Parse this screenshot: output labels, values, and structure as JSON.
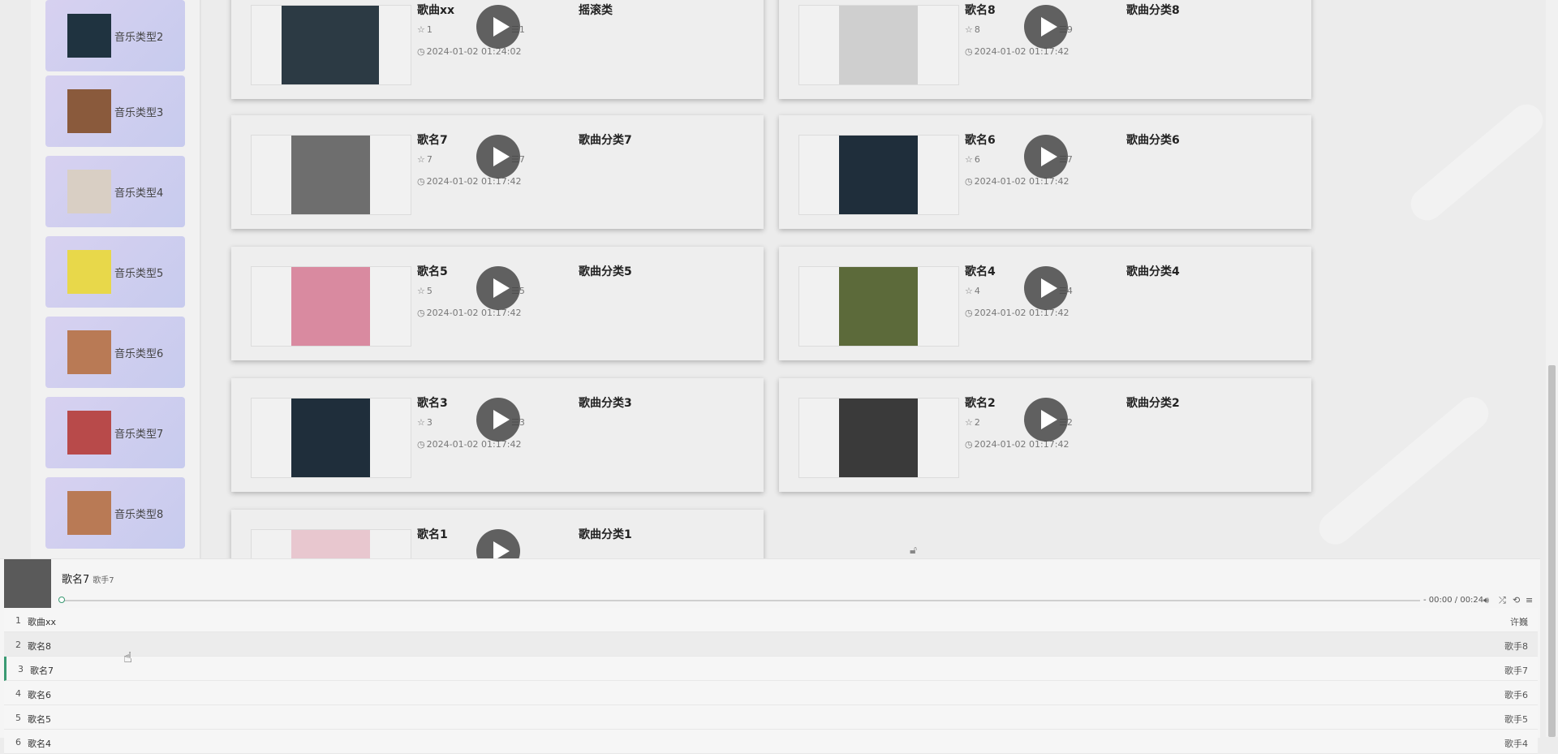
{
  "sidebar": {
    "items": [
      {
        "label": "音乐类型2",
        "color": "#1f3340"
      },
      {
        "label": "音乐类型3",
        "color": "#8a5a3c"
      },
      {
        "label": "音乐类型4",
        "color": "#d9cfc4"
      },
      {
        "label": "音乐类型5",
        "color": "#e8d84a"
      },
      {
        "label": "音乐类型6",
        "color": "#b97a55"
      },
      {
        "label": "音乐类型7",
        "color": "#b84a4a"
      },
      {
        "label": "音乐类型8",
        "color": "#b97a55"
      }
    ]
  },
  "songs": [
    {
      "name": "歌曲xx",
      "category": "摇滚类",
      "favorites": "1",
      "plays": "1",
      "time": "2024-01-02 01:24:02",
      "cover_color": "#2c3a44"
    },
    {
      "name": "歌名8",
      "category": "歌曲分类8",
      "favorites": "8",
      "plays": "9",
      "time": "2024-01-02 01:17:42",
      "cover_color": "#cfcfcf"
    },
    {
      "name": "歌名7",
      "category": "歌曲分类7",
      "favorites": "7",
      "plays": "7",
      "time": "2024-01-02 01:17:42",
      "cover_color": "#6e6e6e"
    },
    {
      "name": "歌名6",
      "category": "歌曲分类6",
      "favorites": "6",
      "plays": "7",
      "time": "2024-01-02 01:17:42",
      "cover_color": "#1f2e3b"
    },
    {
      "name": "歌名5",
      "category": "歌曲分类5",
      "favorites": "5",
      "plays": "5",
      "time": "2024-01-02 01:17:42",
      "cover_color": "#d98aa0"
    },
    {
      "name": "歌名4",
      "category": "歌曲分类4",
      "favorites": "4",
      "plays": "4",
      "time": "2024-01-02 01:17:42",
      "cover_color": "#5c6a3a"
    },
    {
      "name": "歌名3",
      "category": "歌曲分类3",
      "favorites": "3",
      "plays": "3",
      "time": "2024-01-02 01:17:42",
      "cover_color": "#1f2e3b"
    },
    {
      "name": "歌名2",
      "category": "歌曲分类2",
      "favorites": "2",
      "plays": "2",
      "time": "2024-01-02 01:17:42",
      "cover_color": "#3a3a3a"
    },
    {
      "name": "歌名1",
      "category": "歌曲分类1",
      "favorites": "",
      "plays": "",
      "time": "",
      "cover_color": "#e8c7cf"
    }
  ],
  "player": {
    "title": "歌名7",
    "artist": "歌手7",
    "time": "- 00:00 / 00:24",
    "progress": 0,
    "cover_color": "#5a5a5a",
    "accent_color": "#3a9a73",
    "controls": [
      "volume-icon",
      "shuffle-icon",
      "loop-icon",
      "menu-icon"
    ],
    "playlist": [
      {
        "num": "1",
        "name": "歌曲xx",
        "artist": "许巍"
      },
      {
        "num": "2",
        "name": "歌名8",
        "artist": "歌手8"
      },
      {
        "num": "3",
        "name": "歌名7",
        "artist": "歌手7"
      },
      {
        "num": "4",
        "name": "歌名6",
        "artist": "歌手6"
      },
      {
        "num": "5",
        "name": "歌名5",
        "artist": "歌手5"
      },
      {
        "num": "6",
        "name": "歌名4",
        "artist": "歌手4"
      }
    ]
  }
}
